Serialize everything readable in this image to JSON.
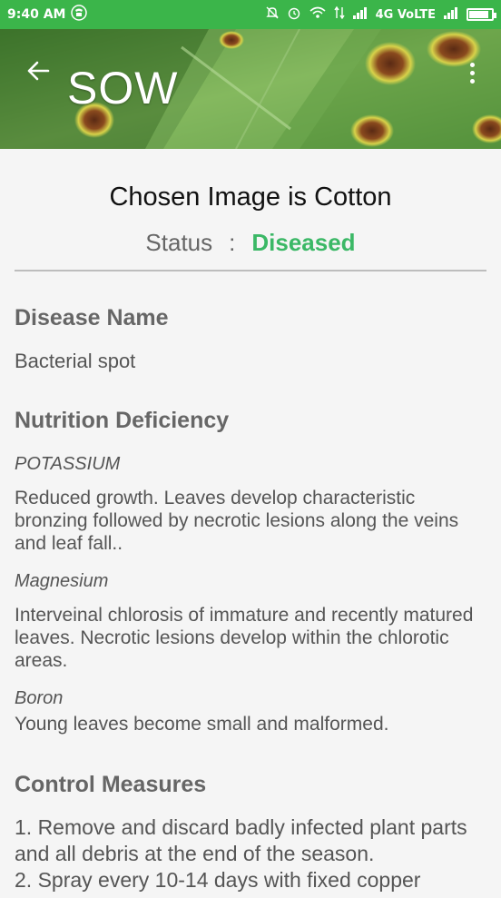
{
  "status_bar": {
    "time": "9:40 AM",
    "network": "4G VoLTE"
  },
  "header": {
    "title": "SOW"
  },
  "result": {
    "chosen_text": "Chosen Image is Cotton",
    "status_label": "Status",
    "status_sep": ":",
    "status_value": "Diseased",
    "status_color": "#3bb866"
  },
  "disease": {
    "heading": "Disease Name",
    "name": "Bacterial spot"
  },
  "nutrition": {
    "heading": "Nutrition Deficiency",
    "items": [
      {
        "name": "POTASSIUM",
        "description": "Reduced growth. Leaves develop characteristic bronzing followed by necrotic lesions along the veins and leaf fall.."
      },
      {
        "name": "Magnesium",
        "description": "Interveinal chlorosis of immature and recently matured leaves. Necrotic lesions develop within the chlorotic areas."
      },
      {
        "name": "Boron",
        "description": "Young leaves become small and malformed."
      }
    ]
  },
  "control": {
    "heading": "Control Measures",
    "text_line1": "1. Remove and discard badly infected plant parts and all debris at the end of the season.",
    "text_line2": "2. Spray every 10-14 days with fixed copper"
  },
  "colors": {
    "status_bar": "#3bb54a",
    "accent_green": "#3bb866"
  }
}
